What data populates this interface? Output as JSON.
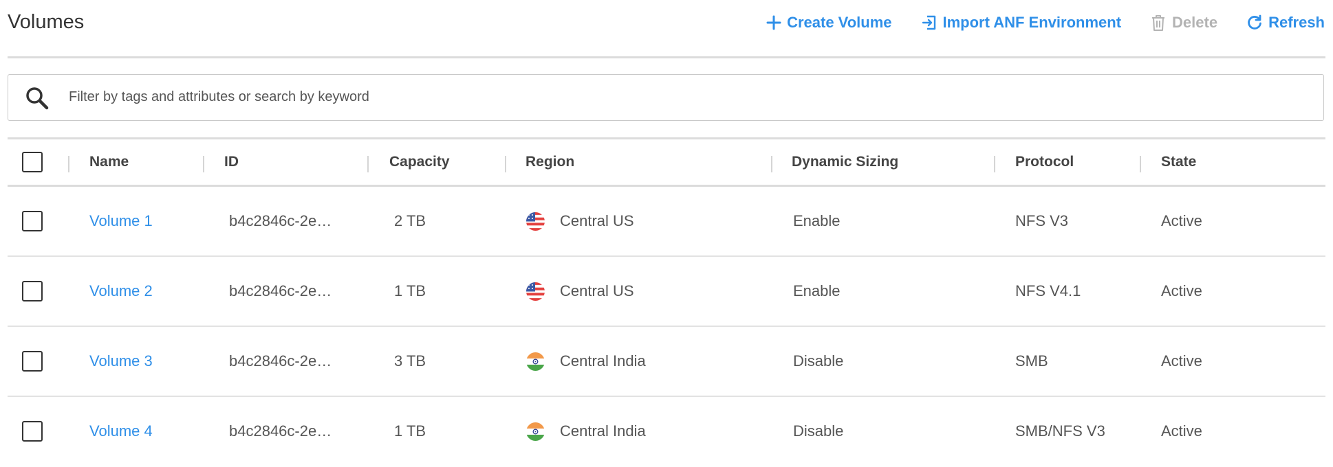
{
  "header": {
    "title": "Volumes",
    "actions": {
      "create": {
        "label": "Create Volume",
        "icon": "plus-icon"
      },
      "import": {
        "label": "Import ANF Environment",
        "icon": "import-icon"
      },
      "delete": {
        "label": "Delete",
        "icon": "trash-icon",
        "disabled": true
      },
      "refresh": {
        "label": "Refresh",
        "icon": "refresh-icon"
      }
    }
  },
  "search": {
    "placeholder": "Filter by tags and attributes or search by keyword",
    "value": ""
  },
  "table": {
    "columns": {
      "name": "Name",
      "id": "ID",
      "capacity": "Capacity",
      "region": "Region",
      "dynamic_sizing": "Dynamic Sizing",
      "protocol": "Protocol",
      "state": "State"
    },
    "rows": [
      {
        "name": "Volume 1",
        "id": "b4c2846c-2e…",
        "capacity": "2 TB",
        "region": "Central US",
        "flag": "us-flag-icon",
        "dynamic_sizing": "Enable",
        "protocol": "NFS V3",
        "state": "Active"
      },
      {
        "name": "Volume 2",
        "id": "b4c2846c-2e…",
        "capacity": "1 TB",
        "region": "Central US",
        "flag": "us-flag-icon",
        "dynamic_sizing": "Enable",
        "protocol": "NFS V4.1",
        "state": "Active"
      },
      {
        "name": "Volume 3",
        "id": "b4c2846c-2e…",
        "capacity": "3 TB",
        "region": "Central India",
        "flag": "india-flag-icon",
        "dynamic_sizing": "Disable",
        "protocol": "SMB",
        "state": "Active"
      },
      {
        "name": "Volume 4",
        "id": "b4c2846c-2e…",
        "capacity": "1 TB",
        "region": "Central India",
        "flag": "india-flag-icon",
        "dynamic_sizing": "Disable",
        "protocol": "SMB/NFS V3",
        "state": "Active"
      }
    ]
  },
  "colors": {
    "accent": "#2f8fe8",
    "disabled": "#b3b3b3",
    "text": "#555555",
    "rule": "#dcdcdc"
  }
}
